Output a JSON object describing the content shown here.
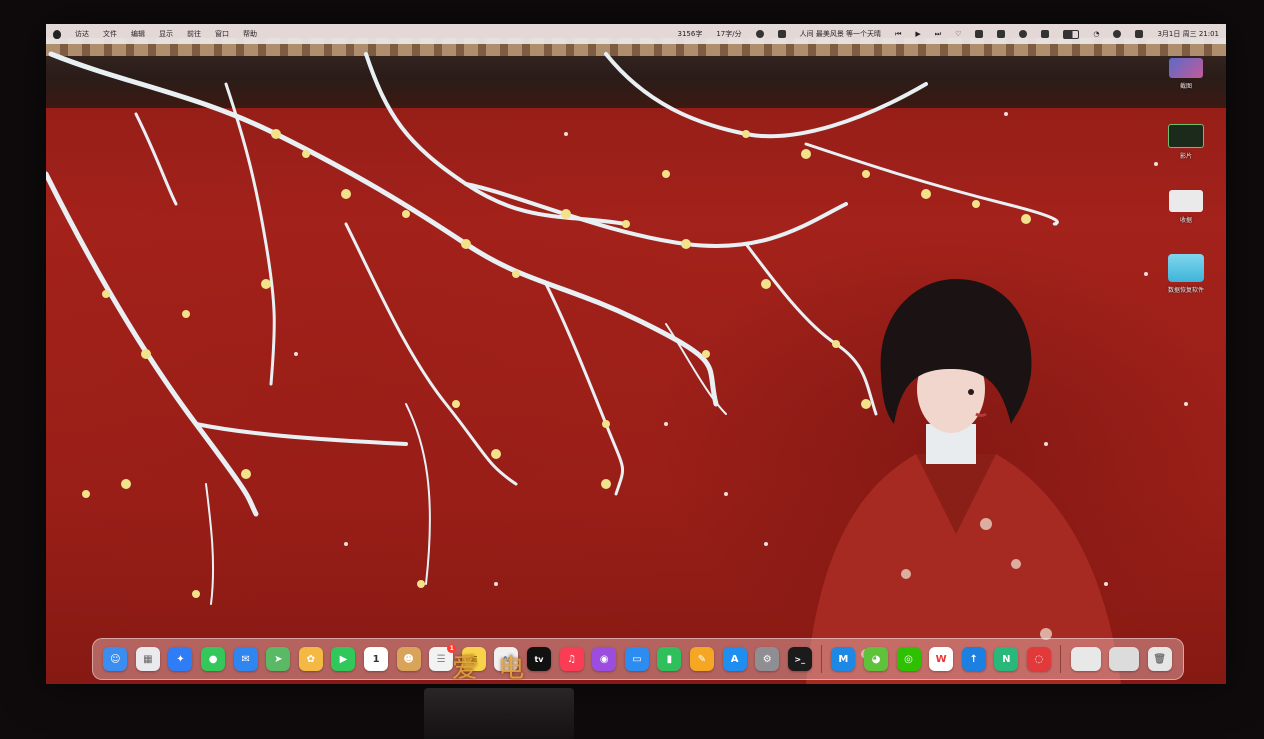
{
  "menubar": {
    "items": [
      "访达",
      "文件",
      "编辑",
      "显示",
      "前往",
      "窗口",
      "帮助"
    ],
    "status": {
      "counter": "3156字",
      "rate": "17字/分",
      "song": "人间 最美风景 等一个天晴",
      "date_time": "3月1日 周三 21:01"
    }
  },
  "desktop": {
    "items": [
      {
        "label": "截图",
        "icon": "photo-thumb-icon"
      },
      {
        "label": "影片",
        "icon": "movie-thumb-icon"
      },
      {
        "label": "收据",
        "icon": "receipt-thumb-icon"
      },
      {
        "label": "数据恢复软件",
        "icon": "folder-icon"
      }
    ]
  },
  "watermark": "爱 电",
  "dock": {
    "apps": [
      {
        "name": "finder",
        "icon": "finder-icon",
        "color": "#3b8ef0"
      },
      {
        "name": "launchpad",
        "icon": "launchpad-icon",
        "color": "#e9e9ee"
      },
      {
        "name": "safari",
        "icon": "safari-icon",
        "color": "#2e7cf6"
      },
      {
        "name": "messages",
        "icon": "messages-icon",
        "color": "#34c759"
      },
      {
        "name": "mail",
        "icon": "mail-icon",
        "color": "#2f86ef"
      },
      {
        "name": "maps",
        "icon": "maps-icon",
        "color": "#59b964"
      },
      {
        "name": "photos",
        "icon": "photos-icon",
        "color": "#f4b942"
      },
      {
        "name": "facetime",
        "icon": "facetime-icon",
        "color": "#30c85a"
      },
      {
        "name": "calendar",
        "icon": "calendar-icon",
        "color": "#ffffff",
        "text": "1"
      },
      {
        "name": "contacts",
        "icon": "contacts-icon",
        "color": "#d9a35a"
      },
      {
        "name": "reminders",
        "icon": "reminders-icon",
        "color": "#f2f2f2",
        "badge": "1"
      },
      {
        "name": "notes",
        "icon": "notes-icon",
        "color": "#f8d24a"
      },
      {
        "name": "freeform",
        "icon": "freeform-icon",
        "color": "#f0f0f0"
      },
      {
        "name": "apple-tv",
        "icon": "apple-tv-icon",
        "color": "#111111",
        "text": "tv"
      },
      {
        "name": "music",
        "icon": "music-icon",
        "color": "#fa3c55"
      },
      {
        "name": "podcasts",
        "icon": "podcasts-icon",
        "color": "#9b4de0"
      },
      {
        "name": "keynote",
        "icon": "keynote-icon",
        "color": "#2d8cf0"
      },
      {
        "name": "numbers",
        "icon": "numbers-icon",
        "color": "#2fbf5b"
      },
      {
        "name": "pages",
        "icon": "pages-icon",
        "color": "#f5a623"
      },
      {
        "name": "app-store",
        "icon": "app-store-icon",
        "color": "#1f8ef1"
      },
      {
        "name": "system-settings",
        "icon": "settings-icon",
        "color": "#8e8e93"
      },
      {
        "name": "terminal",
        "icon": "terminal-icon",
        "color": "#1b1b1b"
      }
    ],
    "extra_apps": [
      {
        "name": "app-xm",
        "icon": "xm-icon",
        "color": "#1e88e5"
      },
      {
        "name": "app-green-bird",
        "icon": "green-bird-icon",
        "color": "#5ec33a"
      },
      {
        "name": "wechat",
        "icon": "wechat-icon",
        "color": "#2dc100"
      },
      {
        "name": "wps",
        "icon": "wps-icon",
        "color": "#ffffff",
        "text": "W"
      },
      {
        "name": "app-arrow",
        "icon": "arrow-app-icon",
        "color": "#1d7fe0"
      },
      {
        "name": "app-n",
        "icon": "n-app-icon",
        "color": "#2ab87a"
      },
      {
        "name": "netease-music",
        "icon": "netease-music-icon",
        "color": "#e23a3a"
      }
    ],
    "recent": [
      {
        "name": "window-thumb-1",
        "icon": "window-thumb-icon",
        "color": "#e8e8e8"
      },
      {
        "name": "window-thumb-2",
        "icon": "window-thumb-icon",
        "color": "#dcdcdc"
      },
      {
        "name": "trash",
        "icon": "trash-icon",
        "color": "#e6e6e6"
      }
    ]
  }
}
